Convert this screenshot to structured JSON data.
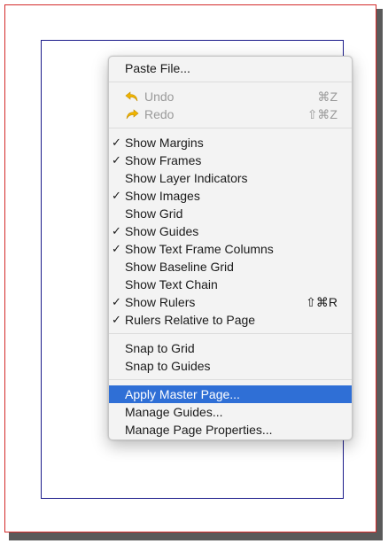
{
  "menu": {
    "paste_file": "Paste File...",
    "undo": {
      "label": "Undo",
      "shortcut": "⌘Z"
    },
    "redo": {
      "label": "Redo",
      "shortcut": "⇧⌘Z"
    },
    "show_margins": "Show Margins",
    "show_frames": "Show Frames",
    "show_layer_indicators": "Show Layer Indicators",
    "show_images": "Show Images",
    "show_grid": "Show Grid",
    "show_guides": "Show Guides",
    "show_text_frame_columns": "Show Text Frame Columns",
    "show_baseline_grid": "Show Baseline Grid",
    "show_text_chain": "Show Text Chain",
    "show_rulers": {
      "label": "Show Rulers",
      "shortcut": "⇧⌘R"
    },
    "rulers_relative": "Rulers Relative to Page",
    "snap_to_grid": "Snap to Grid",
    "snap_to_guides": "Snap to Guides",
    "apply_master_page": "Apply Master Page...",
    "manage_guides": "Manage Guides...",
    "manage_page_properties": "Manage Page Properties..."
  },
  "checkmark": "✓",
  "colors": {
    "highlight": "#2f6fd6",
    "page_border": "#d42a2a",
    "margin_guide": "#1b1b8a",
    "arrow_icon": "#f0b400"
  },
  "icons": {
    "undo": "undo-arrow-icon",
    "redo": "redo-arrow-icon"
  }
}
